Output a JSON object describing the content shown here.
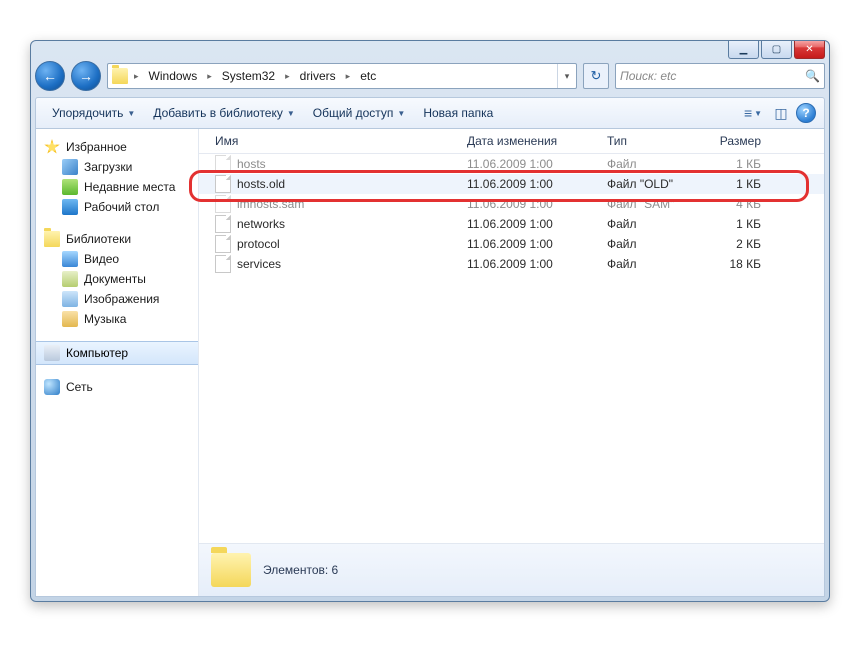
{
  "breadcrumb": [
    "Windows",
    "System32",
    "drivers",
    "etc"
  ],
  "search_placeholder": "Поиск: etc",
  "toolbar": {
    "organize": "Упорядочить",
    "add_lib": "Добавить в библиотеку",
    "share": "Общий доступ",
    "new_folder": "Новая папка"
  },
  "columns": {
    "name": "Имя",
    "date": "Дата изменения",
    "type": "Тип",
    "size": "Размер"
  },
  "sidebar": {
    "favorites": "Избранное",
    "downloads": "Загрузки",
    "recent": "Недавние места",
    "desktop": "Рабочий стол",
    "libraries": "Библиотеки",
    "video": "Видео",
    "documents": "Документы",
    "images": "Изображения",
    "music": "Музыка",
    "computer": "Компьютер",
    "network": "Сеть"
  },
  "files": [
    {
      "name": "hosts",
      "date": "11.06.2009 1:00",
      "type": "Файл",
      "size": "1 КБ"
    },
    {
      "name": "hosts.old",
      "date": "11.06.2009 1:00",
      "type": "Файл \"OLD\"",
      "size": "1 КБ"
    },
    {
      "name": "lmhosts.sam",
      "date": "11.06.2009 1:00",
      "type": "Файл \"SAM\"",
      "size": "4 КБ"
    },
    {
      "name": "networks",
      "date": "11.06.2009 1:00",
      "type": "Файл",
      "size": "1 КБ"
    },
    {
      "name": "protocol",
      "date": "11.06.2009 1:00",
      "type": "Файл",
      "size": "2 КБ"
    },
    {
      "name": "services",
      "date": "11.06.2009 1:00",
      "type": "Файл",
      "size": "18 КБ"
    }
  ],
  "details": {
    "elements_label": "Элементов:",
    "count": "6"
  }
}
